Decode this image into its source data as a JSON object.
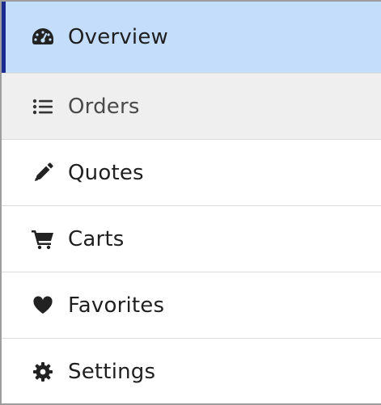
{
  "menu": {
    "items": [
      {
        "label": "Overview",
        "icon": "dashboard-gauge-icon",
        "state": "active"
      },
      {
        "label": "Orders",
        "icon": "list-icon",
        "state": "hover"
      },
      {
        "label": "Quotes",
        "icon": "pencil-icon",
        "state": "normal"
      },
      {
        "label": "Carts",
        "icon": "shopping-cart-icon",
        "state": "normal"
      },
      {
        "label": "Favorites",
        "icon": "heart-icon",
        "state": "normal"
      },
      {
        "label": "Settings",
        "icon": "gear-icon",
        "state": "normal"
      }
    ]
  },
  "colors": {
    "active_background": "#c3ddfb",
    "active_indicator": "#1b2b8f",
    "hover_background": "#efefef",
    "text": "#1f1f1f",
    "divider": "#dcdcdc"
  }
}
